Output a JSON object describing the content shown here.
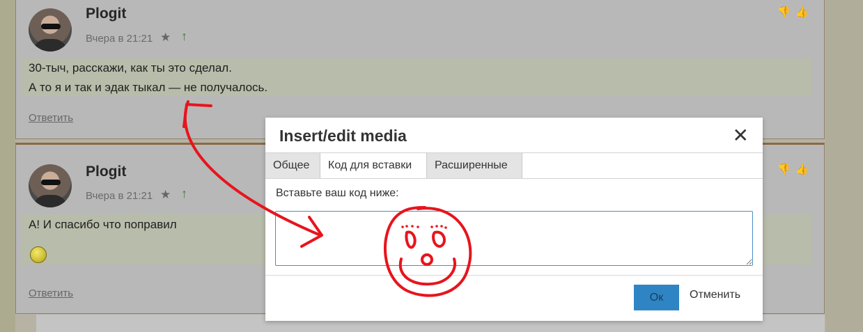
{
  "comments": [
    {
      "author": "Plogit",
      "timestamp": "Вчера в 21:21",
      "lines": [
        "30-тыч, расскажи, как ты это сделал.",
        "А то я и так и эдак тыкал — не получалось."
      ],
      "reply_label": "Ответить"
    },
    {
      "author": "Plogit",
      "timestamp": "Вчера в 21:21",
      "lines": [
        "А! И спасибо что поправил"
      ],
      "reply_label": "Ответить"
    }
  ],
  "icons": {
    "star": "★",
    "upvote": "↑",
    "dislike": "👎",
    "like": "👍",
    "close": "✕"
  },
  "dialog": {
    "title": "Insert/edit media",
    "tabs": [
      {
        "label": "Общее",
        "active": false
      },
      {
        "label": "Код для вставки",
        "active": true
      },
      {
        "label": "Расширенные",
        "active": false
      }
    ],
    "embed_label": "Вставьте ваш код ниже:",
    "embed_value": "",
    "ok_label": "Ок",
    "cancel_label": "Отменить"
  },
  "colors": {
    "accent": "#2f85c3",
    "scribble": "#e8141c"
  }
}
